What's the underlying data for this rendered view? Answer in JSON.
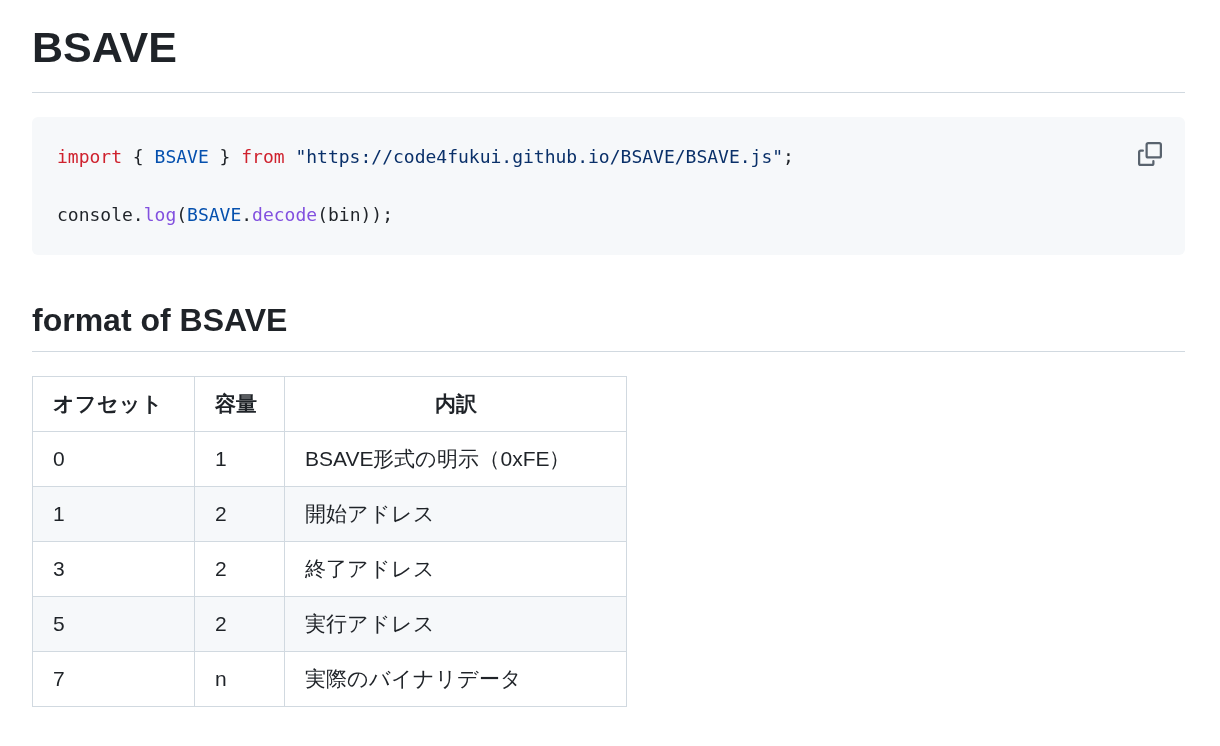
{
  "title": "BSAVE",
  "code": {
    "lines": [
      {
        "tokens": [
          {
            "text": "import",
            "kind": "keyword"
          },
          {
            "text": " { ",
            "kind": "plain"
          },
          {
            "text": "BSAVE",
            "kind": "entity"
          },
          {
            "text": " } ",
            "kind": "plain"
          },
          {
            "text": "from ",
            "kind": "keyword"
          },
          {
            "text": "\"https://code4fukui.github.io/BSAVE/BSAVE.js\"",
            "kind": "string"
          },
          {
            "text": ";",
            "kind": "plain"
          }
        ]
      },
      {
        "tokens": [
          {
            "text": "console.",
            "kind": "plain"
          },
          {
            "text": "log",
            "kind": "function"
          },
          {
            "text": "(",
            "kind": "plain"
          },
          {
            "text": "BSAVE",
            "kind": "entity"
          },
          {
            "text": ".",
            "kind": "plain"
          },
          {
            "text": "decode",
            "kind": "function"
          },
          {
            "text": "(bin));",
            "kind": "plain"
          }
        ]
      }
    ]
  },
  "section": {
    "title": "format of BSAVE",
    "table": {
      "columns": [
        "オフセット",
        "容量",
        "内訳"
      ],
      "rows": [
        [
          "0",
          "1",
          "BSAVE形式の明示（0xFE）"
        ],
        [
          "1",
          "2",
          "開始アドレス"
        ],
        [
          "3",
          "2",
          "終了アドレス"
        ],
        [
          "5",
          "2",
          "実行アドレス"
        ],
        [
          "7",
          "n",
          "実際のバイナリデータ"
        ]
      ]
    }
  }
}
